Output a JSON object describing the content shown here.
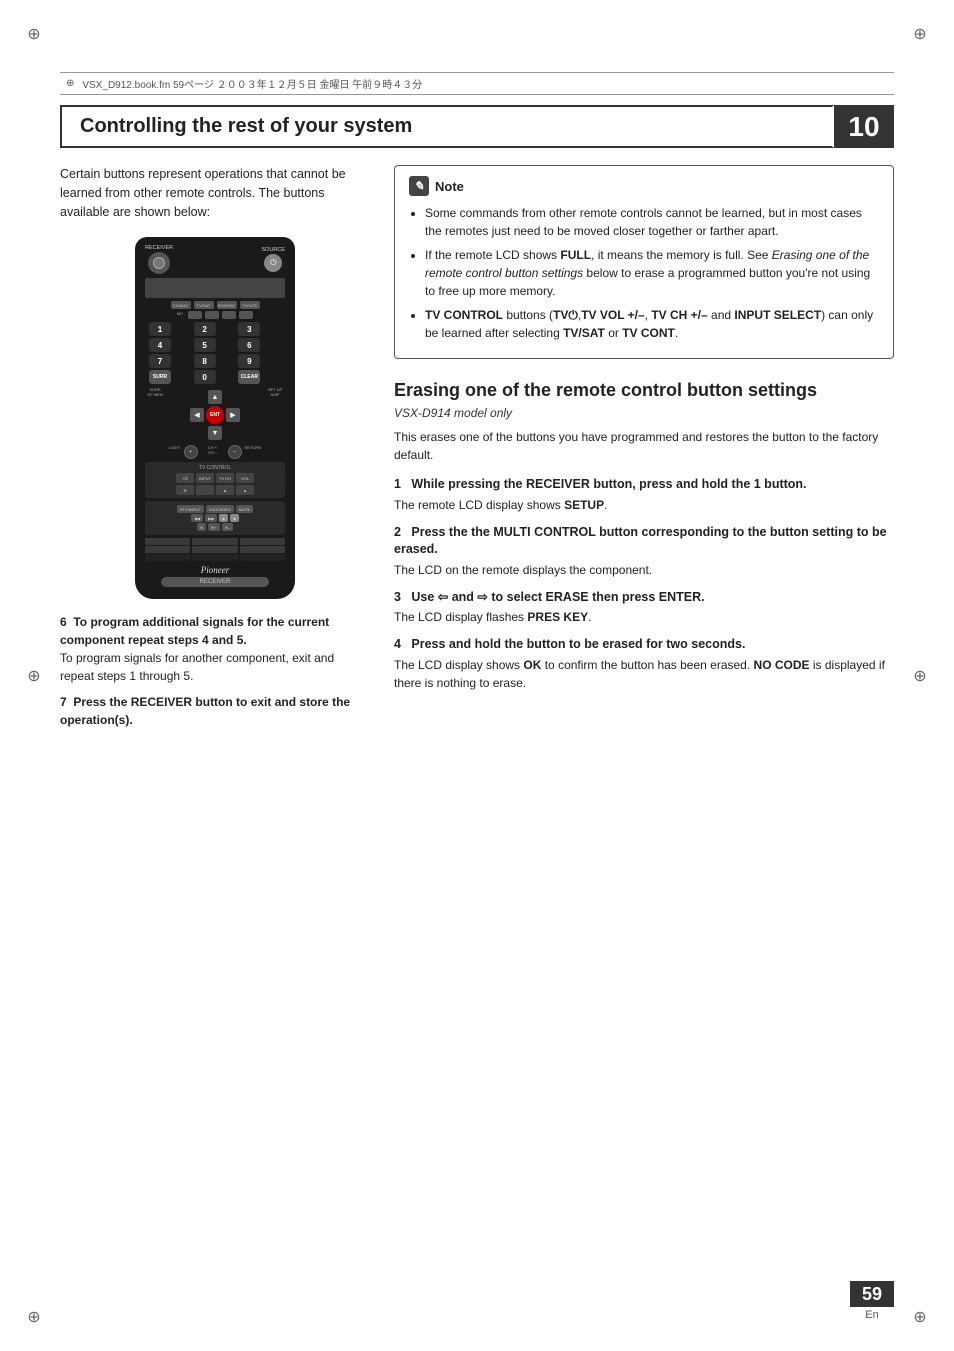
{
  "page": {
    "number": "59",
    "language": "En",
    "chapter": "10"
  },
  "header": {
    "japanese_text": "VSX_D912.book.fm  59ページ  ２００３年１２月５日  金曜日  午前９時４３分"
  },
  "chapter_title": "Controlling the rest of your system",
  "left_col": {
    "intro": "Certain buttons represent operations that cannot be learned from other remote controls. The buttons available are shown below:",
    "step6_label": "6",
    "step6_text": "To program additional signals for the current component repeat steps 4 and 5.",
    "step6_sub": "To program signals for another component, exit and repeat steps 1 through 5.",
    "step7_label": "7",
    "step7_text": "Press the RECEIVER button to exit and store the operation(s)."
  },
  "note": {
    "header": "Note",
    "icon_char": "✎",
    "items": [
      "Some commands from other remote controls cannot be learned, but in most cases the remotes just need to be moved closer together or farther apart.",
      "If the remote LCD shows FULL, it means the memory is full. See Erasing one of the remote control button settings below to erase a programmed button you're not using to free up more memory.",
      "TV CONTROL buttons (TV⏻,TV VOL +/–, TV CH +/– and INPUT SELECT) can only be learned after selecting TV/SAT or TV CONT."
    ],
    "item2_bold": "FULL",
    "item2_italic": "Erasing one of the remote control button settings",
    "item3_bold_parts": [
      "TV CONTROL",
      "TV⏻",
      "TV VOL +/–",
      "TV CH +/–",
      "INPUT SELECT",
      "TV/SAT",
      "TV CONT"
    ]
  },
  "erasing_section": {
    "title": "Erasing one of the remote control button settings",
    "subtitle": "VSX-D914 model only",
    "intro": "This erases one of the buttons you have programmed and restores the button to the factory default.",
    "steps": [
      {
        "number": "1",
        "header": "While pressing the RECEIVER button, press and hold the 1 button.",
        "desc": "The remote LCD display shows SETUP."
      },
      {
        "number": "2",
        "header": "Press the the MULTI CONTROL button corresponding to the button setting to be erased.",
        "desc": "The LCD on the remote displays the component."
      },
      {
        "number": "3",
        "header": "Use ⇦ and ⇨ to select ERASE then press ENTER.",
        "desc": "The LCD display flashes PRES KEY."
      },
      {
        "number": "4",
        "header": "Press and hold the button to be erased for two seconds.",
        "desc": "The LCD display shows OK to confirm the button has been erased. NO CODE is displayed if there is nothing to erase."
      }
    ]
  },
  "remote": {
    "brand": "Pioneer",
    "label": "RECEIVER",
    "nums": [
      "1",
      "2",
      "3",
      "4",
      "5",
      "6",
      "7",
      "8",
      "9",
      "",
      "0",
      ""
    ],
    "source_icon": "⏻"
  }
}
